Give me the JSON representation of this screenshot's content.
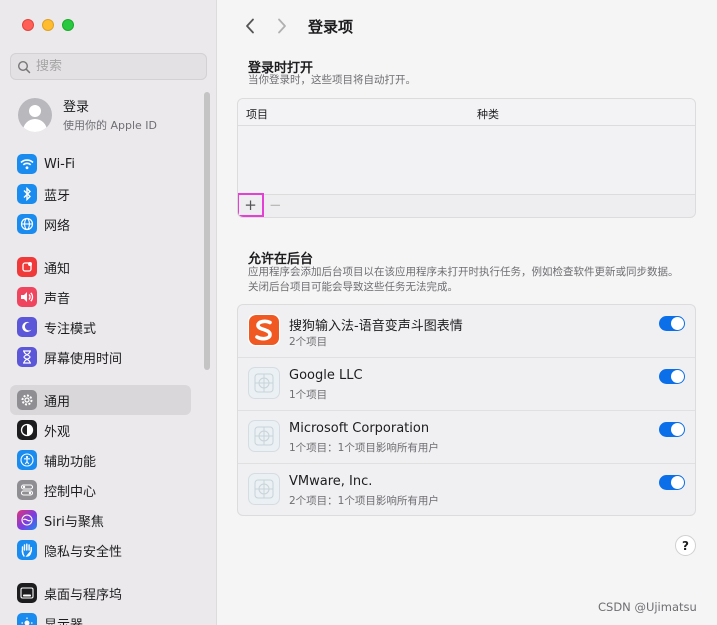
{
  "sidebar": {
    "search_placeholder": "搜索",
    "account": {
      "title": "登录",
      "subtitle": "使用你的 Apple ID"
    },
    "items": [
      {
        "label": "Wi-Fi",
        "icon": "wifi-icon",
        "color": "#1a8cf0"
      },
      {
        "label": "蓝牙",
        "icon": "bluetooth-icon",
        "color": "#1a8cf0"
      },
      {
        "label": "网络",
        "icon": "globe-icon",
        "color": "#1a8cf0"
      },
      {
        "label": "通知",
        "icon": "bell-icon",
        "color": "#f03a3a"
      },
      {
        "label": "声音",
        "icon": "speaker-icon",
        "color": "#f0455f"
      },
      {
        "label": "专注模式",
        "icon": "moon-icon",
        "color": "#5b57d8"
      },
      {
        "label": "屏幕使用时间",
        "icon": "hourglass-icon",
        "color": "#5b57d8"
      },
      {
        "label": "通用",
        "icon": "gear-icon",
        "color": "#8e8e93",
        "active": true
      },
      {
        "label": "外观",
        "icon": "appearance-icon",
        "color": "#1d1d1f"
      },
      {
        "label": "辅助功能",
        "icon": "accessibility-icon",
        "color": "#1a8cf0"
      },
      {
        "label": "控制中心",
        "icon": "control-center-icon",
        "color": "#8e8e93"
      },
      {
        "label": "Siri与聚焦",
        "icon": "siri-icon",
        "color": "#7a3de0"
      },
      {
        "label": "隐私与安全性",
        "icon": "hand-icon",
        "color": "#1a8cf0"
      },
      {
        "label": "桌面与程序坞",
        "icon": "dock-icon",
        "color": "#1d1d1f"
      },
      {
        "label": "显示器",
        "icon": "display-icon",
        "color": "#1a8cf0"
      }
    ]
  },
  "header": {
    "title": "登录项"
  },
  "login_section": {
    "title": "登录时打开",
    "description": "当你登录时，这些项目将自动打开。",
    "columns": [
      "项目",
      "种类"
    ],
    "add_label": "+",
    "remove_label": "−"
  },
  "background_section": {
    "title": "允许在后台",
    "description": "应用程序会添加后台项目以在该应用程序未打开时执行任务，例如检查软件更新或同步数据。关闭后台项目可能会导致这些任务无法完成。",
    "items": [
      {
        "name": "搜狗输入法-语音变声斗图表情",
        "sub": "2个项目",
        "icon": "sogou-icon",
        "enabled": true
      },
      {
        "name": "Google LLC",
        "sub": "1个项目",
        "icon": "app-generic-icon",
        "enabled": true
      },
      {
        "name": "Microsoft Corporation",
        "sub": "1个项目：1个项目影响所有用户",
        "icon": "app-generic-icon",
        "enabled": true
      },
      {
        "name": "VMware, Inc.",
        "sub": "2个项目：1个项目影响所有用户",
        "icon": "app-generic-icon",
        "enabled": true
      }
    ]
  },
  "help_label": "?",
  "watermark": "CSDN @Ujimatsu"
}
